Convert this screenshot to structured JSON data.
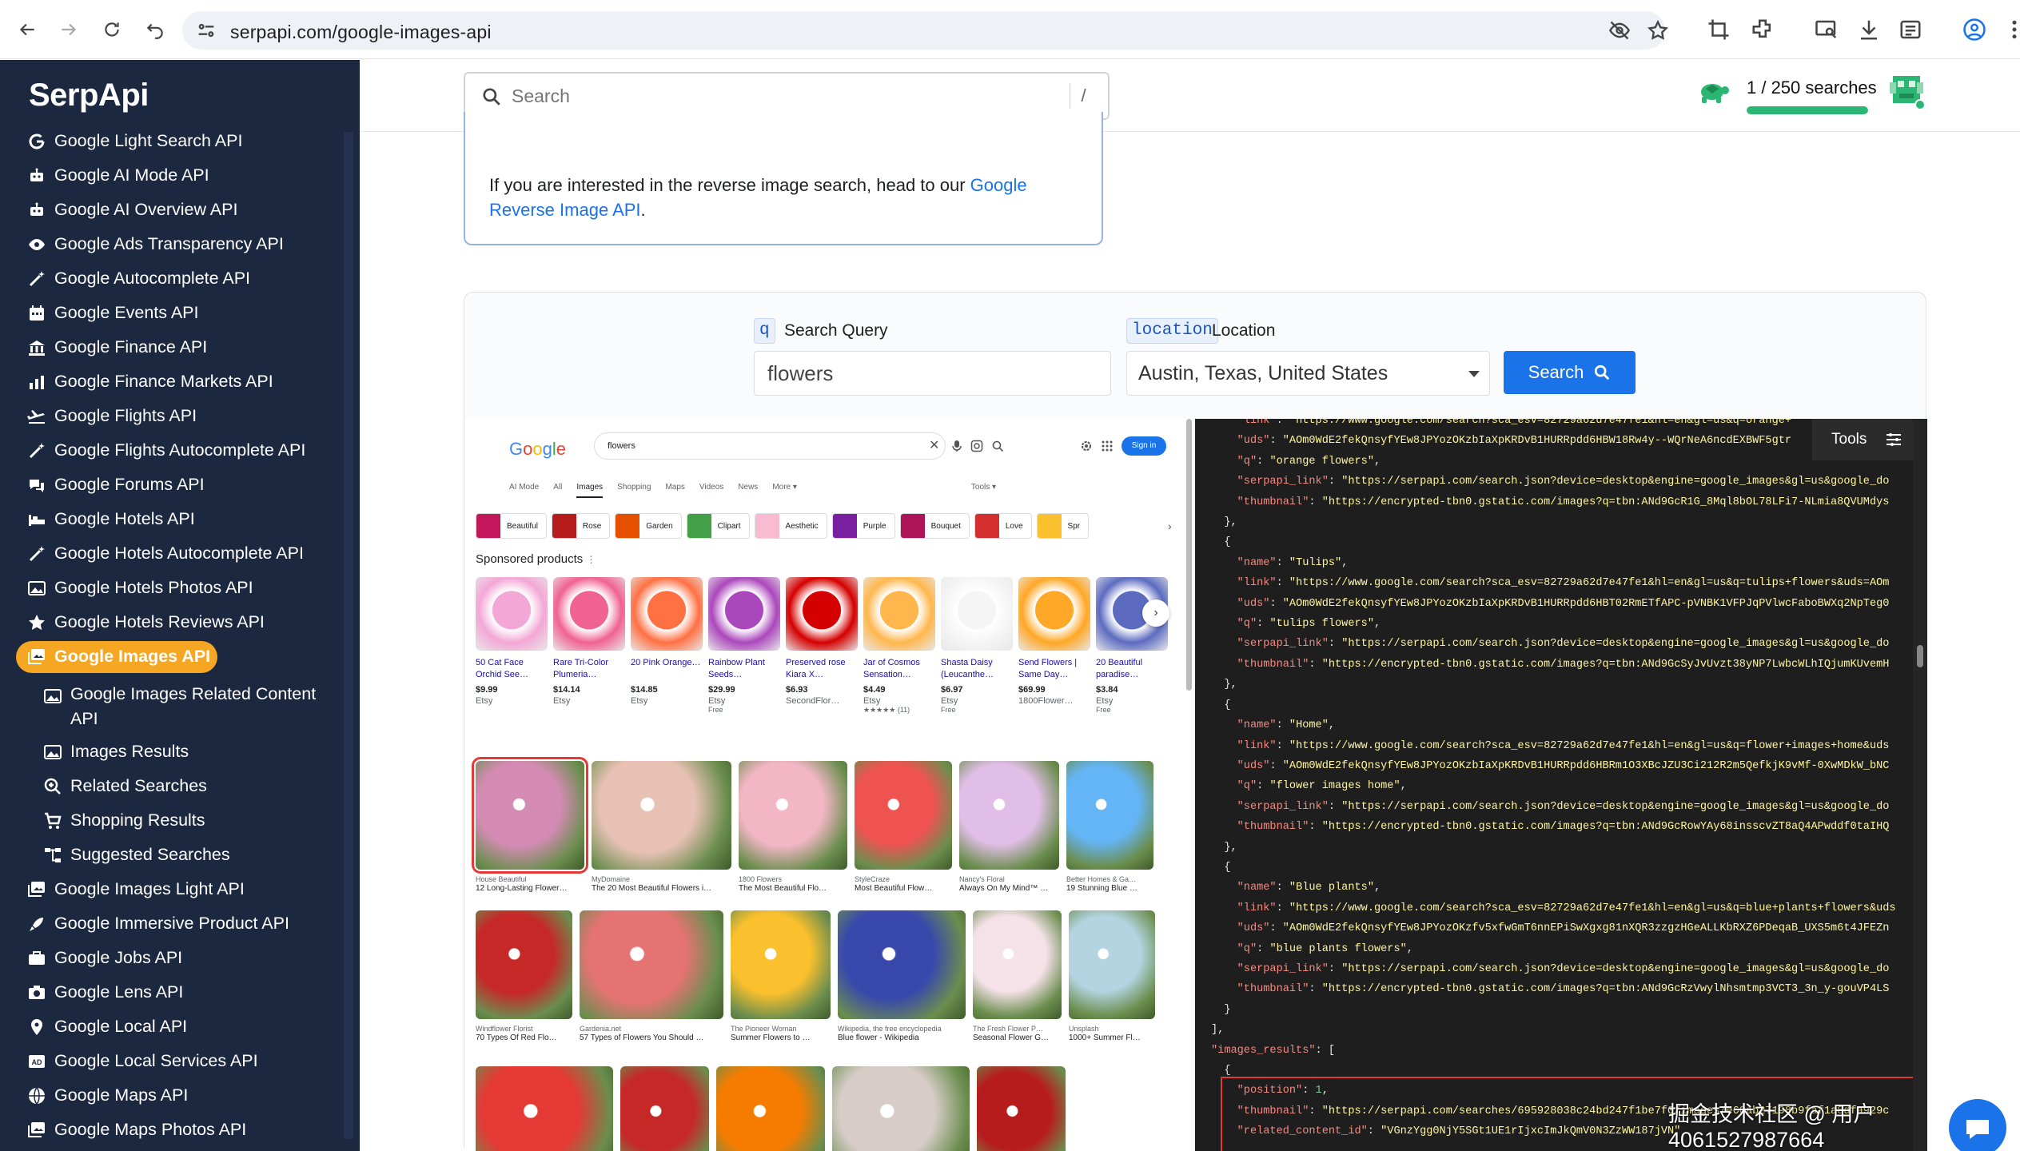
{
  "browser": {
    "url": "serpapi.com/google-images-api"
  },
  "sidebar": {
    "brand": "SerpApi",
    "items": [
      {
        "label": "Google Light Search API",
        "icon": "google-g-icon"
      },
      {
        "label": "Google AI Mode API",
        "icon": "robot-icon"
      },
      {
        "label": "Google AI Overview API",
        "icon": "robot-icon"
      },
      {
        "label": "Google Ads Transparency API",
        "icon": "eye-icon"
      },
      {
        "label": "Google Autocomplete API",
        "icon": "magic-wand-icon"
      },
      {
        "label": "Google Events API",
        "icon": "calendar-icon"
      },
      {
        "label": "Google Finance API",
        "icon": "bank-icon"
      },
      {
        "label": "Google Finance Markets API",
        "icon": "chart-icon"
      },
      {
        "label": "Google Flights API",
        "icon": "plane-icon"
      },
      {
        "label": "Google Flights Autocomplete API",
        "icon": "magic-wand-icon"
      },
      {
        "label": "Google Forums API",
        "icon": "chat-icon"
      },
      {
        "label": "Google Hotels API",
        "icon": "bed-icon"
      },
      {
        "label": "Google Hotels Autocomplete API",
        "icon": "magic-wand-icon"
      },
      {
        "label": "Google Hotels Photos API",
        "icon": "image-icon"
      },
      {
        "label": "Google Hotels Reviews API",
        "icon": "star-icon"
      },
      {
        "label": "Google Images API",
        "icon": "images-icon",
        "active": true
      },
      {
        "label": "Google Images Related Content API",
        "icon": "image-icon",
        "sub": true
      },
      {
        "label": "Images Results",
        "icon": "image-icon",
        "sub": true
      },
      {
        "label": "Related Searches",
        "icon": "search-plus-icon",
        "sub": true
      },
      {
        "label": "Shopping Results",
        "icon": "cart-icon",
        "sub": true
      },
      {
        "label": "Suggested Searches",
        "icon": "sitemap-icon",
        "sub": true
      },
      {
        "label": "Google Images Light API",
        "icon": "images-icon"
      },
      {
        "label": "Google Immersive Product API",
        "icon": "rocket-icon"
      },
      {
        "label": "Google Jobs API",
        "icon": "briefcase-icon"
      },
      {
        "label": "Google Lens API",
        "icon": "camera-icon"
      },
      {
        "label": "Google Local API",
        "icon": "pin-icon"
      },
      {
        "label": "Google Local Services API",
        "icon": "ad-icon"
      },
      {
        "label": "Google Maps API",
        "icon": "globe-icon"
      },
      {
        "label": "Google Maps Photos API",
        "icon": "images-icon"
      }
    ]
  },
  "topbar": {
    "search_placeholder": "Search",
    "shortcut": "/",
    "usage_text": "1 / 250 searches",
    "usage_fraction": 0.004,
    "accent": "#2bb673"
  },
  "info": {
    "text_before": "If you are interested in the reverse image search, head to our ",
    "link_text": "Google Reverse Image API",
    "text_after": "."
  },
  "playground": {
    "q_badge": "q",
    "q_label": "Search Query",
    "q_value": "flowers",
    "loc_badge": "location",
    "loc_label": "Location",
    "loc_value": "Austin, Texas, United States",
    "search_button": "Search",
    "tools_label": "Tools"
  },
  "google_preview": {
    "logo": "Google",
    "query": "flowers",
    "sign_in": "Sign in",
    "tabs": [
      "AI Mode",
      "All",
      "Images",
      "Shopping",
      "Maps",
      "Videos",
      "News",
      "More ▾",
      "Tools ▾"
    ],
    "chips": [
      {
        "label": "Beautiful",
        "color": "#c2185b"
      },
      {
        "label": "Rose",
        "color": "#b71c1c"
      },
      {
        "label": "Garden",
        "color": "#e65100"
      },
      {
        "label": "Clipart",
        "color": "#43a047"
      },
      {
        "label": "Aesthetic",
        "color": "#f8bbd0"
      },
      {
        "label": "Purple",
        "color": "#7b1fa2"
      },
      {
        "label": "Bouquet",
        "color": "#ad1457"
      },
      {
        "label": "Love",
        "color": "#d32f2f"
      },
      {
        "label": "Spr",
        "color": "#fbc02d"
      }
    ],
    "sponsored_label": "Sponsored products",
    "products": [
      {
        "name": "50 Cat Face Orchid See…",
        "price": "$9.99",
        "store": "Etsy",
        "extra": "",
        "color": "#f3a7d6"
      },
      {
        "name": "Rare Tri-Color Plumeria…",
        "price": "$14.14",
        "store": "Etsy",
        "extra": "",
        "color": "#f06292"
      },
      {
        "name": "20 Pink Orange…",
        "price": "$14.85",
        "store": "Etsy",
        "extra": "",
        "color": "#ff7043"
      },
      {
        "name": "Rainbow Plant Seeds…",
        "price": "$29.99",
        "store": "Etsy",
        "extra": "Free",
        "color": "#ab47bc"
      },
      {
        "name": "Preserved rose Kiara X…",
        "price": "$6.93",
        "store": "SecondFlor…",
        "extra": "",
        "color": "#d50000"
      },
      {
        "name": "Jar of Cosmos Sensation…",
        "price": "$4.49",
        "store": "Etsy",
        "extra": "★★★★★ (11)",
        "color": "#ffb74d"
      },
      {
        "name": "Shasta Daisy (Leucanthe…",
        "price": "$6.97",
        "store": "Etsy",
        "extra": "Free",
        "color": "#f5f5f5"
      },
      {
        "name": "Send Flowers | Same Day…",
        "price": "$69.99",
        "store": "1800Flower…",
        "extra": "",
        "color": "#ffa726"
      },
      {
        "name": "20 Beautiful paradise…",
        "price": "$3.84",
        "store": "Etsy",
        "extra": "Free",
        "color": "#5c6bc0"
      }
    ],
    "image_rows": [
      [
        {
          "src": "House Beautiful",
          "cap": "12 Long-Lasting Flower…",
          "color": "#d48bb3",
          "w": 136,
          "sel": true
        },
        {
          "src": "MyDomaine",
          "cap": "The 20 Most Beautiful Flowers i…",
          "color": "#e8c1b5",
          "w": 175
        },
        {
          "src": "1800 Flowers",
          "cap": "The Most Beautiful Flo…",
          "color": "#f2b6c5",
          "w": 136
        },
        {
          "src": "StyleCraze",
          "cap": "Most Beautiful Flow…",
          "color": "#ef5350",
          "w": 122
        },
        {
          "src": "Nancy's Floral",
          "cap": "Always On My Mind™ …",
          "color": "#e1bee7",
          "w": 125
        },
        {
          "src": "Better Homes & Ga…",
          "cap": "19 Stunning Blue …",
          "color": "#64b5f6",
          "w": 109
        }
      ],
      [
        {
          "src": "Windflower Florist",
          "cap": "70 Types Of Red Flo…",
          "color": "#c62828",
          "w": 121
        },
        {
          "src": "Gardenia.net",
          "cap": "57 Types of Flowers You Should …",
          "color": "#e57373",
          "w": 180
        },
        {
          "src": "The Pioneer Woman",
          "cap": "Summer Flowers to …",
          "color": "#fbc02d",
          "w": 125
        },
        {
          "src": "Wikipedia, the free encyclopedia",
          "cap": "Blue flower - Wikipedia",
          "color": "#3949ab",
          "w": 160
        },
        {
          "src": "The Fresh Flower P…",
          "cap": "Seasonal Flower G…",
          "color": "#f5e1e8",
          "w": 111
        },
        {
          "src": "Unsplash",
          "cap": "1000+ Summer Fl…",
          "color": "#b3d4e0",
          "w": 108
        }
      ],
      [
        {
          "src": "",
          "cap": "",
          "color": "#e53935",
          "w": 172
        },
        {
          "src": "",
          "cap": "",
          "color": "#c62828",
          "w": 111
        },
        {
          "src": "",
          "cap": "",
          "color": "#f57c00",
          "w": 136
        },
        {
          "src": "",
          "cap": "",
          "color": "#d7ccc8",
          "w": 172
        },
        {
          "src": "",
          "cap": "",
          "color": "#b71c1c",
          "w": 111
        }
      ]
    ]
  },
  "json_lines": [
    [
      [
        "p",
        "    "
      ],
      [
        "k",
        "\"link\""
      ],
      [
        "p",
        ": "
      ],
      [
        "s",
        "\"https://www.google.com/search?sca_esv=82729a62d7e47fe1&hl=en&gl=us&q=orange+"
      ]
    ],
    [
      [
        "p",
        "    "
      ],
      [
        "k",
        "\"uds\""
      ],
      [
        "p",
        ": "
      ],
      [
        "s",
        "\"AOm0WdE2fekQnsyfYEw8JPYozOKzbIaXpKRDvB1HURRpdd6HBW18Rw4y--WQrNeA6ncdEXBWF5gtr"
      ]
    ],
    [
      [
        "p",
        "    "
      ],
      [
        "k",
        "\"q\""
      ],
      [
        "p",
        ": "
      ],
      [
        "s",
        "\"orange flowers\""
      ],
      [
        "p",
        ","
      ]
    ],
    [
      [
        "p",
        "    "
      ],
      [
        "k",
        "\"serpapi_link\""
      ],
      [
        "p",
        ": "
      ],
      [
        "s",
        "\"https://serpapi.com/search.json?device=desktop&engine=google_images&gl=us&google_do"
      ]
    ],
    [
      [
        "p",
        "    "
      ],
      [
        "k",
        "\"thumbnail\""
      ],
      [
        "p",
        ": "
      ],
      [
        "s",
        "\"https://encrypted-tbn0.gstatic.com/images?q=tbn:ANd9GcR1G_8Mql8bOL78LFi7-NLmia8QVUMdys"
      ]
    ],
    [
      [
        "p",
        "  },"
      ]
    ],
    [
      [
        "p",
        "  {"
      ]
    ],
    [
      [
        "p",
        "    "
      ],
      [
        "k",
        "\"name\""
      ],
      [
        "p",
        ": "
      ],
      [
        "s",
        "\"Tulips\""
      ],
      [
        "p",
        ","
      ]
    ],
    [
      [
        "p",
        "    "
      ],
      [
        "k",
        "\"link\""
      ],
      [
        "p",
        ": "
      ],
      [
        "s",
        "\"https://www.google.com/search?sca_esv=82729a62d7e47fe1&hl=en&gl=us&q=tulips+flowers&uds=AOm"
      ]
    ],
    [
      [
        "p",
        "    "
      ],
      [
        "k",
        "\"uds\""
      ],
      [
        "p",
        ": "
      ],
      [
        "s",
        "\"AOm0WdE2fekQnsyfYEw8JPYozOKzbIaXpKRDvB1HURRpdd6HBT02RmETfAPC-pVNBK1VFPJqPVlwcFaboBWXq2NpTeg0"
      ]
    ],
    [
      [
        "p",
        "    "
      ],
      [
        "k",
        "\"q\""
      ],
      [
        "p",
        ": "
      ],
      [
        "s",
        "\"tulips flowers\""
      ],
      [
        "p",
        ","
      ]
    ],
    [
      [
        "p",
        "    "
      ],
      [
        "k",
        "\"serpapi_link\""
      ],
      [
        "p",
        ": "
      ],
      [
        "s",
        "\"https://serpapi.com/search.json?device=desktop&engine=google_images&gl=us&google_do"
      ]
    ],
    [
      [
        "p",
        "    "
      ],
      [
        "k",
        "\"thumbnail\""
      ],
      [
        "p",
        ": "
      ],
      [
        "s",
        "\"https://encrypted-tbn0.gstatic.com/images?q=tbn:ANd9GcSyJvUvzt38yNP7LwbcWLhIQjumKUvemH"
      ]
    ],
    [
      [
        "p",
        "  },"
      ]
    ],
    [
      [
        "p",
        "  {"
      ]
    ],
    [
      [
        "p",
        "    "
      ],
      [
        "k",
        "\"name\""
      ],
      [
        "p",
        ": "
      ],
      [
        "s",
        "\"Home\""
      ],
      [
        "p",
        ","
      ]
    ],
    [
      [
        "p",
        "    "
      ],
      [
        "k",
        "\"link\""
      ],
      [
        "p",
        ": "
      ],
      [
        "s",
        "\"https://www.google.com/search?sca_esv=82729a62d7e47fe1&hl=en&gl=us&q=flower+images+home&uds"
      ]
    ],
    [
      [
        "p",
        "    "
      ],
      [
        "k",
        "\"uds\""
      ],
      [
        "p",
        ": "
      ],
      [
        "s",
        "\"AOm0WdE2fekQnsyfYEw8JPYozOKzbIaXpKRDvB1HURRpdd6HBRm1O3XBcJZU3Ci212R2m5QefkjK9vMf-0XwMDkW_bNC"
      ]
    ],
    [
      [
        "p",
        "    "
      ],
      [
        "k",
        "\"q\""
      ],
      [
        "p",
        ": "
      ],
      [
        "s",
        "\"flower images home\""
      ],
      [
        "p",
        ","
      ]
    ],
    [
      [
        "p",
        "    "
      ],
      [
        "k",
        "\"serpapi_link\""
      ],
      [
        "p",
        ": "
      ],
      [
        "s",
        "\"https://serpapi.com/search.json?device=desktop&engine=google_images&gl=us&google_do"
      ]
    ],
    [
      [
        "p",
        "    "
      ],
      [
        "k",
        "\"thumbnail\""
      ],
      [
        "p",
        ": "
      ],
      [
        "s",
        "\"https://encrypted-tbn0.gstatic.com/images?q=tbn:ANd9GcRowYAy68insscvZT8aQ4APwddf0taIHQ"
      ]
    ],
    [
      [
        "p",
        "  },"
      ]
    ],
    [
      [
        "p",
        "  {"
      ]
    ],
    [
      [
        "p",
        "    "
      ],
      [
        "k",
        "\"name\""
      ],
      [
        "p",
        ": "
      ],
      [
        "s",
        "\"Blue plants\""
      ],
      [
        "p",
        ","
      ]
    ],
    [
      [
        "p",
        "    "
      ],
      [
        "k",
        "\"link\""
      ],
      [
        "p",
        ": "
      ],
      [
        "s",
        "\"https://www.google.com/search?sca_esv=82729a62d7e47fe1&hl=en&gl=us&q=blue+plants+flowers&uds"
      ]
    ],
    [
      [
        "p",
        "    "
      ],
      [
        "k",
        "\"uds\""
      ],
      [
        "p",
        ": "
      ],
      [
        "s",
        "\"AOm0WdE2fekQnsyfYEw8JPYozOKzfv5xfwGmT6nnEPiSwXgxg81nXQR3zzgzHGeALLKbRXZ6PDeqaB_UXS5m6t4JFEZn"
      ]
    ],
    [
      [
        "p",
        "    "
      ],
      [
        "k",
        "\"q\""
      ],
      [
        "p",
        ": "
      ],
      [
        "s",
        "\"blue plants flowers\""
      ],
      [
        "p",
        ","
      ]
    ],
    [
      [
        "p",
        "    "
      ],
      [
        "k",
        "\"serpapi_link\""
      ],
      [
        "p",
        ": "
      ],
      [
        "s",
        "\"https://serpapi.com/search.json?device=desktop&engine=google_images&gl=us&google_do"
      ]
    ],
    [
      [
        "p",
        "    "
      ],
      [
        "k",
        "\"thumbnail\""
      ],
      [
        "p",
        ": "
      ],
      [
        "s",
        "\"https://encrypted-tbn0.gstatic.com/images?q=tbn:ANd9GcRzVwylNhsmtmp3VCT3_3n_y-gouVP4LS"
      ]
    ],
    [
      [
        "p",
        "  }"
      ]
    ],
    [
      [
        "p",
        "],"
      ]
    ],
    [
      [
        "k",
        "\"images_results\""
      ],
      [
        "p",
        ": ["
      ]
    ],
    [
      [
        "p",
        "  {"
      ]
    ],
    [
      [
        "p",
        "    "
      ],
      [
        "k",
        "\"position\""
      ],
      [
        "p",
        ": "
      ],
      [
        "n",
        "1"
      ],
      [
        "p",
        ","
      ]
    ],
    [
      [
        "p",
        "    "
      ],
      [
        "k",
        "\"thumbnail\""
      ],
      [
        "p",
        ": "
      ],
      [
        "s",
        "\"https://serpapi.com/searches/695928038c24bd247f1be7f0/images/e60ab27198b9faf1a8dfa929c"
      ]
    ],
    [
      [
        "p",
        "    "
      ],
      [
        "k",
        "\"related_content_id\""
      ],
      [
        "p",
        ": "
      ],
      [
        "s",
        "\"VGnzYgg0NjY5SGt1UE1rIjxcImJkQmV0N3ZzWW187jVN\""
      ]
    ]
  ],
  "watermark": "掘金技术社区 @ 用户4061527987664"
}
